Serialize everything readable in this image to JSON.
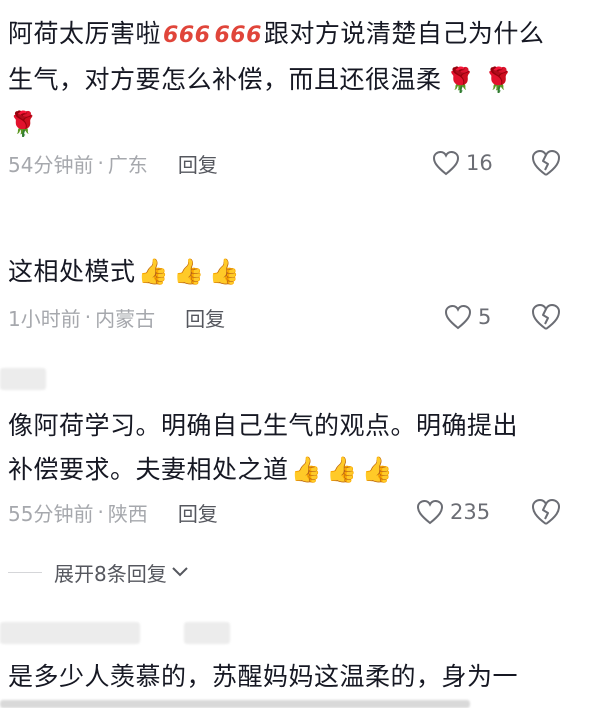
{
  "comments": [
    {
      "text_parts": [
        "阿荷太厉害啦",
        "666",
        "666",
        "跟对方说清楚自己为什么",
        "生气，对方要怎么补偿，而且还很温柔"
      ],
      "emoji_name": "rose",
      "time": "54分钟前",
      "location": "广东",
      "reply_label": "回复",
      "likes": "16"
    },
    {
      "text": "这相处模式",
      "emoji_name": "thumbs-up",
      "time": "1小时前",
      "location": "内蒙古",
      "reply_label": "回复",
      "likes": "5"
    },
    {
      "text_line1": "像阿荷学习。明确自己生气的观点。明确提出",
      "text_line2": "补偿要求。夫妻相处之道",
      "emoji_name": "thumbs-up",
      "time": "55分钟前",
      "location": "陕西",
      "reply_label": "回复",
      "likes": "235"
    },
    {
      "text_line1": "是多少人羡慕的，苏醒妈妈这温柔的，身为一"
    }
  ],
  "expand_replies": "展开8条回复",
  "separator": "·",
  "colors": {
    "text": "#161823",
    "meta": "#a6a8ad",
    "reply": "#55575e",
    "rose": "#e64b52",
    "accent_666": "#e0453a"
  }
}
